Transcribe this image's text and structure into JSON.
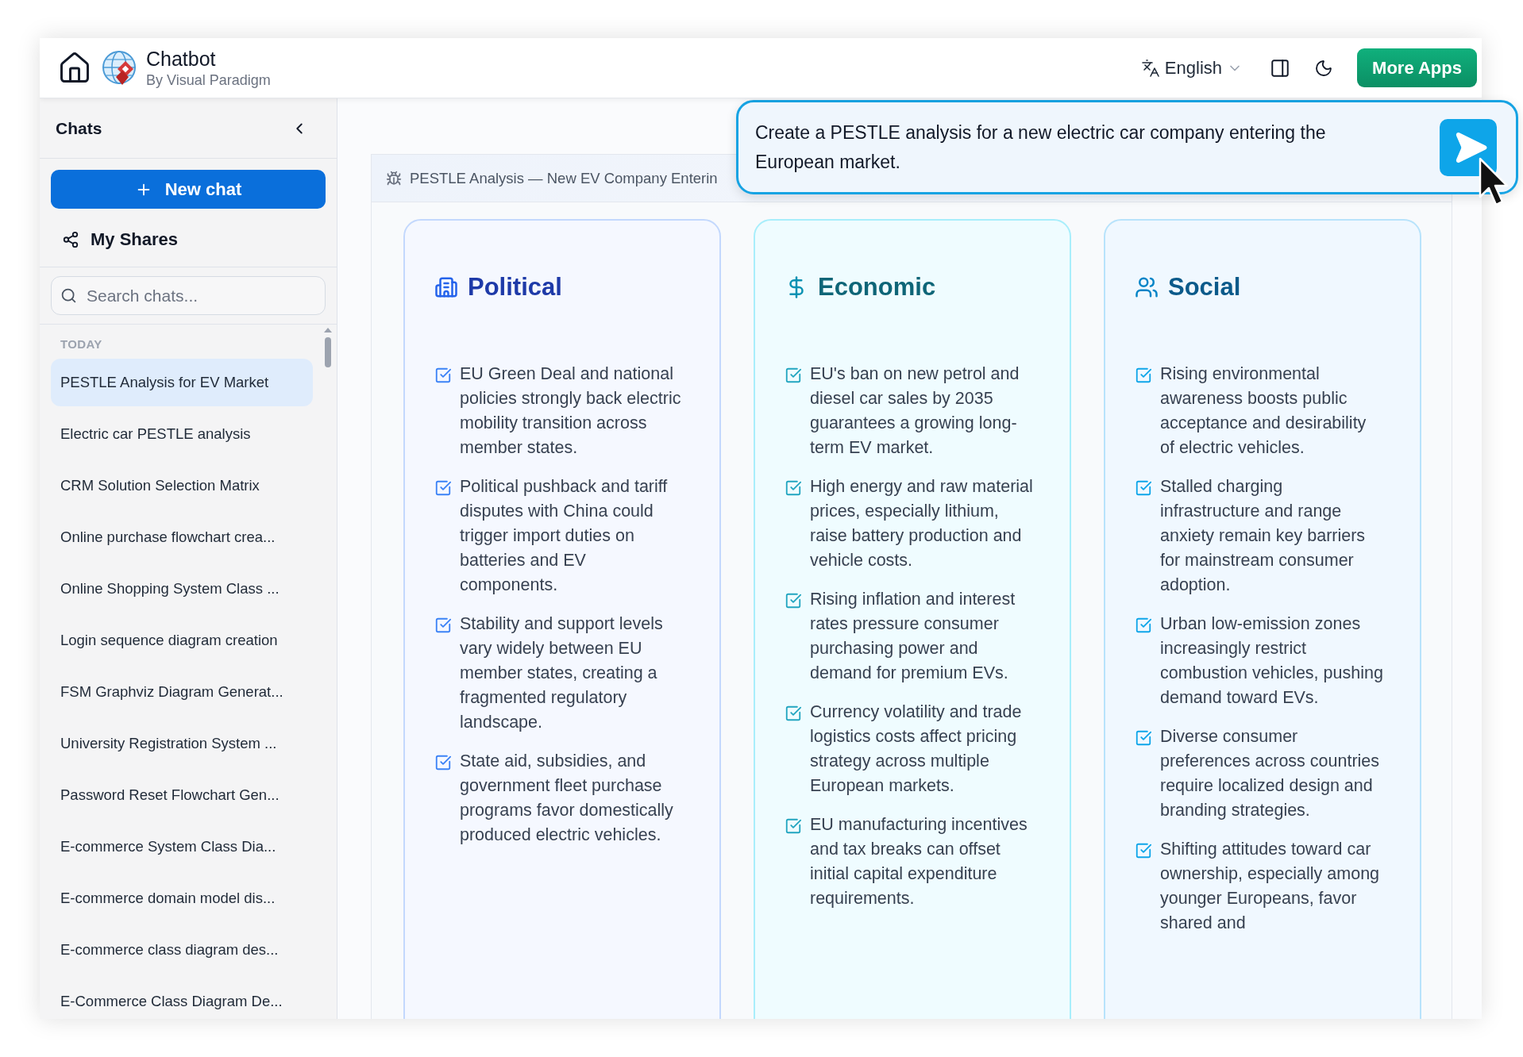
{
  "header": {
    "title": "Chatbot",
    "subtitle": "By Visual Paradigm",
    "language": "English",
    "more_apps": "More Apps"
  },
  "sidebar": {
    "title": "Chats",
    "new_chat": "New chat",
    "my_shares": "My Shares",
    "search": {
      "placeholder": "Search chats..."
    },
    "section": "TODAY",
    "items": [
      {
        "label": "PESTLE Analysis for EV Market",
        "selected": true
      },
      {
        "label": "Electric car PESTLE analysis",
        "selected": false
      },
      {
        "label": "CRM Solution Selection Matrix",
        "selected": false
      },
      {
        "label": "Online purchase flowchart crea...",
        "selected": false
      },
      {
        "label": "Online Shopping System Class ...",
        "selected": false
      },
      {
        "label": "Login sequence diagram creation",
        "selected": false
      },
      {
        "label": "FSM Graphviz Diagram Generat...",
        "selected": false
      },
      {
        "label": "University Registration System ...",
        "selected": false
      },
      {
        "label": "Password Reset Flowchart Gen...",
        "selected": false
      },
      {
        "label": "E-commerce System Class Dia...",
        "selected": false
      },
      {
        "label": "E-commerce domain model dis...",
        "selected": false
      },
      {
        "label": "E-commerce class diagram des...",
        "selected": false
      },
      {
        "label": "E-Commerce Class Diagram De...",
        "selected": false
      }
    ]
  },
  "panel": {
    "title": "PESTLE Analysis — New EV Company Enterin",
    "cards": [
      {
        "kind": "political",
        "title": "Political",
        "items": [
          "EU Green Deal and national policies strongly back electric mobility transition across member states.",
          "Political pushback and tariff disputes with China could trigger import duties on batteries and EV components.",
          "Stability and support levels vary widely between EU member states, creating a fragmented regulatory landscape.",
          "State aid, subsidies, and government fleet purchase programs favor domestically produced electric vehicles."
        ]
      },
      {
        "kind": "economic",
        "title": "Economic",
        "items": [
          "EU's ban on new petrol and diesel car sales by 2035 guarantees a growing long-term EV market.",
          "High energy and raw material prices, especially lithium, raise battery production and vehicle costs.",
          "Rising inflation and interest rates pressure consumer purchasing power and demand for premium EVs.",
          "Currency volatility and trade logistics costs affect pricing strategy across multiple European markets.",
          "EU manufacturing incentives and tax breaks can offset initial capital expenditure requirements."
        ]
      },
      {
        "kind": "social",
        "title": "Social",
        "items": [
          "Rising environmental awareness boosts public acceptance and desirability of electric vehicles.",
          "Stalled charging infrastructure and range anxiety remain key barriers for mainstream consumer adoption.",
          "Urban low-emission zones increasingly restrict combustion vehicles, pushing demand toward EVs.",
          "Diverse consumer preferences across countries require localized design and branding strategies.",
          "Shifting attitudes toward car ownership, especially among younger Europeans, favor shared and"
        ]
      }
    ]
  },
  "prompt": {
    "text": "Create a PESTLE analysis for a new electric car company entering the European market."
  }
}
